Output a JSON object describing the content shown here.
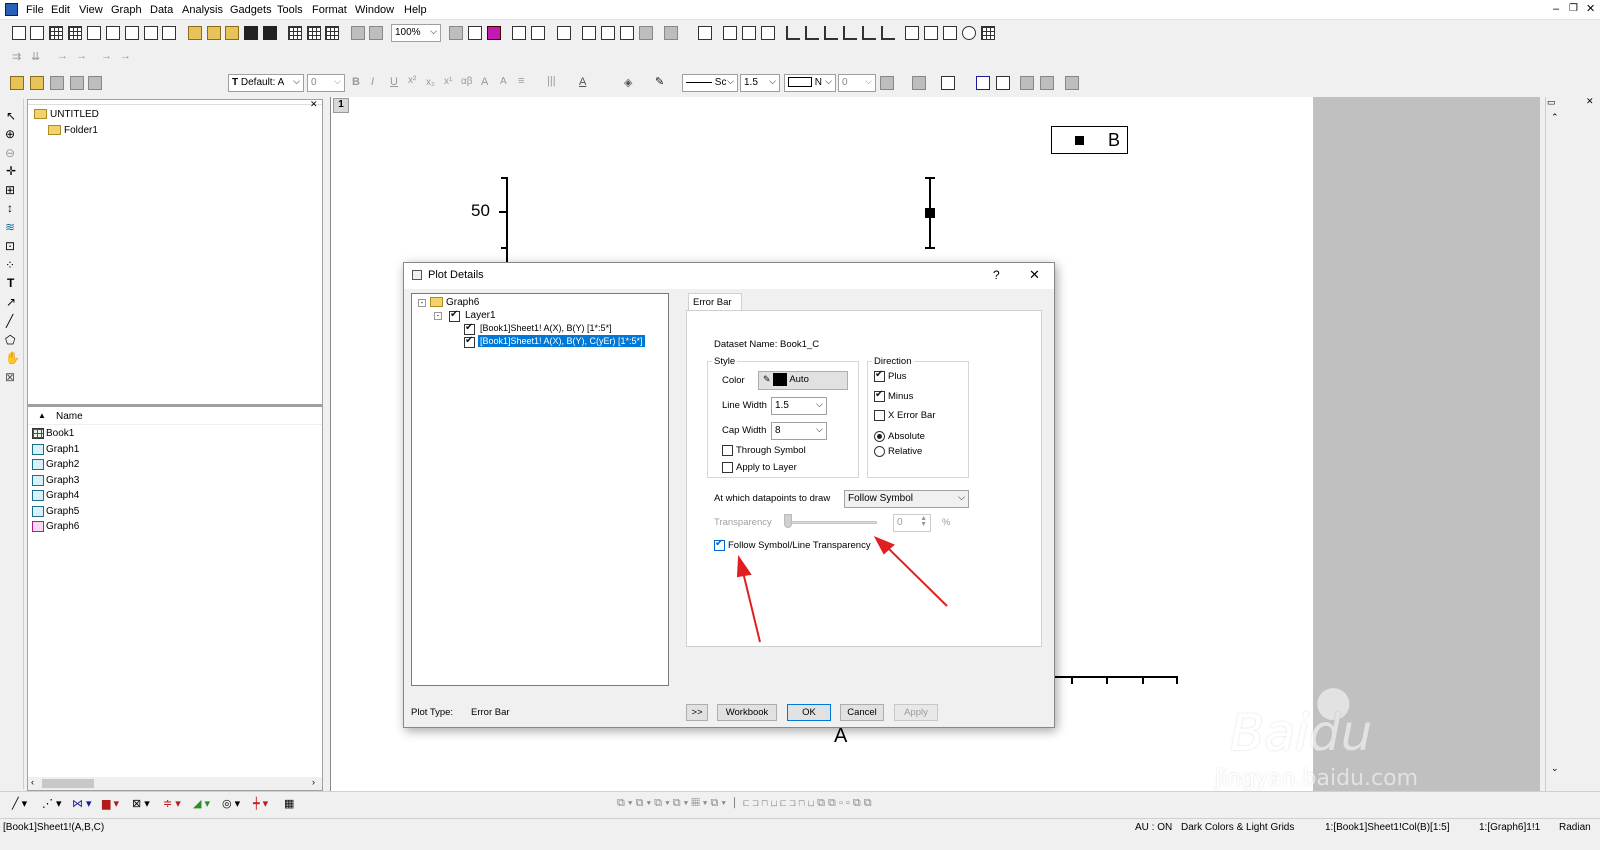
{
  "menubar": {
    "items": [
      "File",
      "Edit",
      "View",
      "Graph",
      "Data",
      "Analysis",
      "Gadgets",
      "Tools",
      "Format",
      "Window",
      "Help"
    ]
  },
  "toolbar": {
    "zoom": "100%",
    "font_name": "Default: A",
    "font_size": "0",
    "line_style": "Sc",
    "line_width": "1.5",
    "fill_label": "N",
    "fill_value": "0"
  },
  "explorer": {
    "project": "UNTITLED",
    "folder": "Folder1",
    "column_header": "Name",
    "items": [
      {
        "label": "Book1",
        "type": "book"
      },
      {
        "label": "Graph1",
        "type": "graph"
      },
      {
        "label": "Graph2",
        "type": "graph"
      },
      {
        "label": "Graph3",
        "type": "graph"
      },
      {
        "label": "Graph4",
        "type": "graph"
      },
      {
        "label": "Graph5",
        "type": "graph"
      },
      {
        "label": "Graph6",
        "type": "graph"
      }
    ]
  },
  "graph": {
    "layer_number": "1",
    "y_tick_label": "50",
    "legend_label": "B",
    "x_axis_label": "A"
  },
  "dialog": {
    "title": "Plot Details",
    "help": "?",
    "close": "✕",
    "tree": {
      "root": "Graph6",
      "layer": "Layer1",
      "plot1": "[Book1]Sheet1! A(X), B(Y) [1*:5*]",
      "plot2": "[Book1]Sheet1! A(X), B(Y), C(yEr) [1*:5*]"
    },
    "tab": "Error Bar",
    "dataset_name": "Dataset Name: Book1_C",
    "style_group": "Style",
    "color_label": "Color",
    "color_value": "Auto",
    "line_width_label": "Line Width",
    "line_width_value": "1.5",
    "cap_width_label": "Cap Width",
    "cap_width_value": "8",
    "through_symbol": "Through Symbol",
    "apply_to_layer": "Apply to Layer",
    "direction_group": "Direction",
    "plus": "Plus",
    "minus": "Minus",
    "x_error_bar": "X Error Bar",
    "absolute": "Absolute",
    "relative": "Relative",
    "datapoints_label": "At which datapoints to draw",
    "datapoints_value": "Follow Symbol",
    "transparency_label": "Transparency",
    "transparency_value": "0",
    "transparency_unit": "%",
    "follow_transparency": "Follow Symbol/Line Transparency",
    "plot_type_label": "Plot Type:",
    "plot_type_value": "Error Bar",
    "buttons": {
      "expand": ">>",
      "workbook": "Workbook",
      "ok": "OK",
      "cancel": "Cancel",
      "apply": "Apply"
    }
  },
  "statusbar": {
    "left": "[Book1]Sheet1!(A,B,C)",
    "au": "AU : ON",
    "theme": "Dark Colors & Light Grids",
    "col": "1:[Book1]Sheet1!Col(B)[1:5]",
    "graph": "1:[Graph6]1!1",
    "angle": "Radian"
  },
  "colors": {
    "selection": "#0078d7",
    "arrow": "#e02020",
    "dark_gray": "#c0c0c0"
  }
}
